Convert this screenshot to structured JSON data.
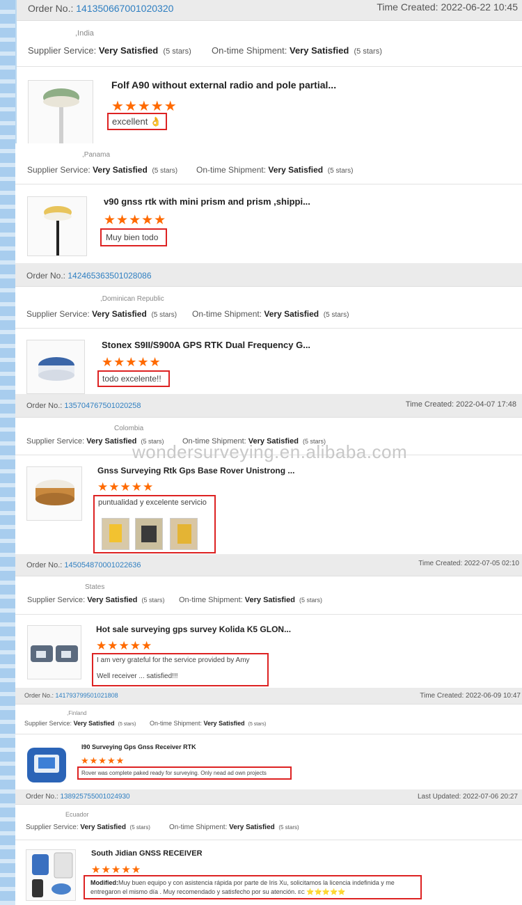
{
  "order_label": "Order No.:",
  "reviews": [
    {
      "order_no": "141350667001020320",
      "time_label": "Time Created:",
      "time": "2022-06-22 10:45",
      "country": ",India",
      "supplier_label": "Supplier Service:",
      "supplier_value": "Very Satisfied",
      "supplier_stars": "(5 stars)",
      "shipment_label": "On-time Shipment:",
      "shipment_value": "Very Satisfied",
      "shipment_stars": "(5 stars)",
      "product": "Folf A90 without external radio and pole partial...",
      "rating": "★★★★★",
      "comment": "excellent 👌"
    },
    {
      "country": ",Panama",
      "supplier_label": "Supplier Service:",
      "supplier_value": "Very Satisfied",
      "supplier_stars": "(5 stars)",
      "shipment_label": "On-time Shipment:",
      "shipment_value": "Very Satisfied",
      "shipment_stars": "(5 stars)",
      "product": "v90 gnss rtk with mini prism and prism ,shippi...",
      "rating": "★★★★★",
      "comment": "Muy bien todo"
    },
    {
      "order_no": "142465363501028086",
      "country": ",Dominican Republic",
      "supplier_label": "Supplier Service:",
      "supplier_value": "Very Satisfied",
      "supplier_stars": "(5 stars)",
      "shipment_label": "On-time Shipment:",
      "shipment_value": "Very Satisfied",
      "shipment_stars": "(5 stars)",
      "product": "Stonex S9II/S900A GPS RTK Dual Frequency G...",
      "rating": "★★★★★",
      "comment": "todo excelente!!"
    },
    {
      "order_no": "135704767501020258",
      "time_label": "Time Created:",
      "time": "2022-04-07 17:48",
      "country": "Colombia",
      "supplier_label": "Supplier Service:",
      "supplier_value": "Very Satisfied",
      "supplier_stars": "(5 stars)",
      "shipment_label": "On-time Shipment:",
      "shipment_value": "Very Satisfied",
      "shipment_stars": "(5 stars)",
      "product": "Gnss Surveying Rtk Gps Base Rover Unistrong ...",
      "rating": "★★★★★",
      "comment": "puntualidad y excelente servicio"
    },
    {
      "order_no": "145054870001022636",
      "time_label": "Time Created:",
      "time": "2022-07-05 02:10",
      "country": "States",
      "supplier_label": "Supplier Service:",
      "supplier_value": "Very Satisfied",
      "supplier_stars": "(5 stars)",
      "shipment_label": "On-time Shipment:",
      "shipment_value": "Very Satisfied",
      "shipment_stars": "(5 stars)",
      "product": "Hot sale surveying gps survey Kolida K5 GLON...",
      "rating": "★★★★★",
      "comment_line1": "I am very grateful for the service provided by Amy",
      "comment_line2": "Well receiver ... satisfied!!!"
    },
    {
      "order_no": "141793799501021808",
      "time_label": "Time Created:",
      "time": "2022-06-09 10:47",
      "country": ",Finland",
      "supplier_label": "Supplier Service:",
      "supplier_value": "Very Satisfied",
      "supplier_stars": "(5 stars)",
      "shipment_label": "On-time Shipment:",
      "shipment_value": "Very Satisfied",
      "shipment_stars": "(5 stars)",
      "product": "I90 Surveying Gps Gnss Receiver RTK",
      "rating": "★★★★★",
      "comment": "Rover was complete paked ready for surveying. Only nead ad own projects"
    },
    {
      "order_no": "138925755001024930",
      "time_label": "Last Updated:",
      "time": "2022-07-06 20:27",
      "country": "Ecuador",
      "supplier_label": "Supplier Service:",
      "supplier_value": "Very Satisfied",
      "supplier_stars": "(5 stars)",
      "shipment_label": "On-time Shipment:",
      "shipment_value": "Very Satisfied",
      "shipment_stars": "(5 stars)",
      "product": "South Jidian GNSS RECEIVER",
      "rating": "★★★★★",
      "modified_label": "Modified:",
      "comment": "Muy buen equipo y con asistencia rápida por parte de Iris Xu, solicitamos la licencia indefinida y me entregaron el mismo día . Muy recomendado y satisfecho por su atención.",
      "comment_tail": "EC",
      "comment_emoji_stars": "⭐⭐⭐⭐⭐"
    }
  ],
  "watermark": "wondersurveying.en.alibaba.com",
  "colors": {
    "star": "#ff6a00",
    "link": "#2f7fc1",
    "highlight_border": "#dd2222",
    "header_bg": "#ebebeb",
    "side_strip": "#a8cdee"
  }
}
